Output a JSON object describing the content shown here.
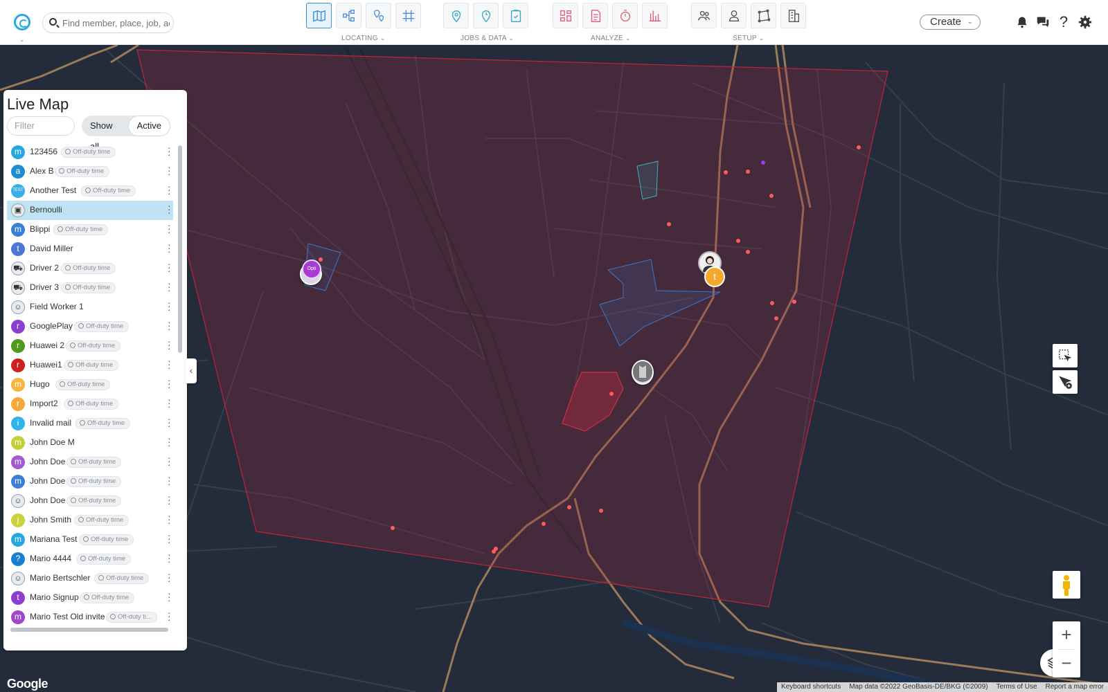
{
  "search": {
    "placeholder": "Find member, place, job, ac"
  },
  "nav": {
    "groups": [
      {
        "label": "LOCATING"
      },
      {
        "label": "JOBS & DATA"
      },
      {
        "label": "ANALYZE"
      },
      {
        "label": "SETUP"
      }
    ]
  },
  "header": {
    "create_label": "Create"
  },
  "panel": {
    "title": "Live Map",
    "filter_placeholder": "Filter",
    "show_all": "Show all",
    "active": "Active"
  },
  "members": [
    {
      "name": "123456",
      "avatar": "m",
      "color": "#29a8e0",
      "status": "Off-duty time"
    },
    {
      "name": "Alex B",
      "avatar": "a",
      "color": "#1b8fd0",
      "status": "Off-duty time"
    },
    {
      "name": "Another Test",
      "avatar": "TEST",
      "color": "#3ab0e6",
      "status": "Off-duty time"
    },
    {
      "name": "Bernoulli",
      "avatar": "photo",
      "color": "#e9ecef",
      "status": ""
    },
    {
      "name": "Blippi",
      "avatar": "m",
      "color": "#3a7fd6",
      "status": "Off-duty time"
    },
    {
      "name": "David Miller",
      "avatar": "t",
      "color": "#4a78d2",
      "status": ""
    },
    {
      "name": "Driver 2",
      "avatar": "truck",
      "color": "#e9ecef",
      "status": "Off-duty time"
    },
    {
      "name": "Driver 3",
      "avatar": "truck",
      "color": "#e9ecef",
      "status": "Off-duty time"
    },
    {
      "name": "Field Worker 1",
      "avatar": "worker",
      "color": "#e9ecef",
      "status": ""
    },
    {
      "name": "GooglePlay",
      "avatar": "r",
      "color": "#8e3fd1",
      "status": "Off-duty time"
    },
    {
      "name": "Huawei 2",
      "avatar": "r",
      "color": "#4f9a1f",
      "status": "Off-duty time"
    },
    {
      "name": "Huawei1",
      "avatar": "r",
      "color": "#d11e1e",
      "status": "Off-duty time"
    },
    {
      "name": "Hugo",
      "avatar": "m",
      "color": "#f4b63f",
      "status": "Off-duty time"
    },
    {
      "name": "Import2",
      "avatar": "r",
      "color": "#f4a83a",
      "status": "Off-duty time"
    },
    {
      "name": "Invalid mail",
      "avatar": "i",
      "color": "#2fb3e8",
      "status": "Off-duty time"
    },
    {
      "name": "John Doe M",
      "avatar": "m",
      "color": "#c6cf3a",
      "status": ""
    },
    {
      "name": "John Doe",
      "avatar": "m",
      "color": "#a45ad1",
      "status": "Off-duty time"
    },
    {
      "name": "John Doe",
      "avatar": "m",
      "color": "#3a7fd6",
      "status": "Off-duty time"
    },
    {
      "name": "John Doe",
      "avatar": "worker",
      "color": "#e9ecef",
      "status": "Off-duty time"
    },
    {
      "name": "John Smith",
      "avatar": "j",
      "color": "#c9d23a",
      "status": "Off-duty time"
    },
    {
      "name": "Mariana Test",
      "avatar": "m",
      "color": "#29a8e0",
      "status": "Off-duty time"
    },
    {
      "name": "Mario 4444",
      "avatar": "?",
      "color": "#1b7fd0",
      "status": "Off-duty time"
    },
    {
      "name": "Mario Bertschler",
      "avatar": "worker",
      "color": "#e9ecef",
      "status": "Off-duty time"
    },
    {
      "name": "Mario Signup",
      "avatar": "t",
      "color": "#8e3fd1",
      "status": "Off-duty time"
    },
    {
      "name": "Mario Test Old invite",
      "avatar": "m",
      "color": "#a148c9",
      "status": "Off-duty ti..."
    },
    {
      "name": "Mario Test",
      "avatar": "m",
      "color": "#f4b63f",
      "status": "Off-duty time"
    }
  ],
  "map": {
    "marker_opti_label": "Opti",
    "marker_t_label": "t",
    "google": "Google",
    "attribution": [
      "Keyboard shortcuts",
      "Map data ©2022 GeoBasis-DE/BKG (©2009)",
      "Terms of Use",
      "Report a map error"
    ]
  },
  "colors": {
    "accent": "#29a8e0",
    "map_bg": "#232b3a",
    "zone_red": "#c0253a",
    "zone_blue": "#3a78c8",
    "zone_teal": "#3ab3c0",
    "road_brown": "#a57f55",
    "poi_red": "#ff5a5f"
  }
}
